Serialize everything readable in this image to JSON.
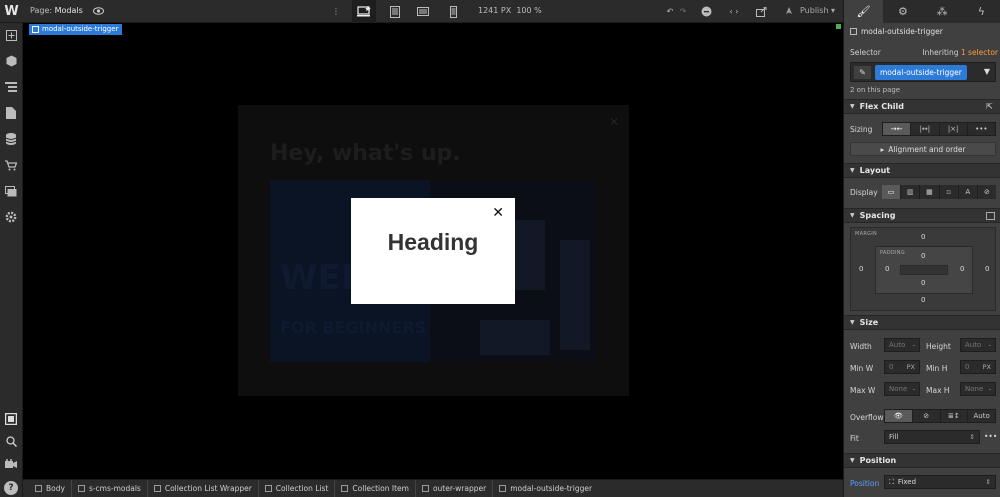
{
  "topbar": {
    "logo": "W",
    "page_prefix": "Page:",
    "page_name": "Modals",
    "canvas_width": "1241",
    "canvas_unit": "PX",
    "zoom": "100 %",
    "publish_label": "Publish"
  },
  "canvas": {
    "selected_tag": "modal-outside-trigger",
    "background_heading": "Hey, what's up.",
    "background_video_title": "WEB",
    "background_video_subtitle": "FOR BEGINNERS",
    "modal_heading": "Heading",
    "modal_close": "✕"
  },
  "breadcrumbs": [
    "Body",
    "s-cms-modals",
    "Collection List Wrapper",
    "Collection List",
    "Collection Item",
    "outer-wrapper",
    "modal-outside-trigger"
  ],
  "panel": {
    "element_name": "modal-outside-trigger",
    "selector_label": "Selector",
    "inheriting_label": "Inheriting",
    "inheriting_count": "1 selector",
    "selector_chip": "modal-outside-trigger",
    "on_page": "2 on this page",
    "flex_child": {
      "title": "Flex Child",
      "sizing_label": "Sizing",
      "alignment_button": "Alignment and order"
    },
    "layout": {
      "title": "Layout",
      "display_label": "Display"
    },
    "spacing": {
      "title": "Spacing",
      "margin_caption": "MARGIN",
      "padding_caption": "PADDING",
      "margin_top": "0",
      "margin_right": "0",
      "margin_bottom": "0",
      "margin_left": "0",
      "padding_top": "0",
      "padding_right": "0",
      "padding_bottom": "0",
      "padding_left": "0"
    },
    "size": {
      "title": "Size",
      "width_label": "Width",
      "width_value": "Auto",
      "height_label": "Height",
      "height_value": "Auto",
      "minw_label": "Min W",
      "minw_value": "0",
      "minw_unit": "PX",
      "minh_label": "Min H",
      "minh_value": "0",
      "minh_unit": "PX",
      "maxw_label": "Max W",
      "maxw_value": "None",
      "maxh_label": "Max H",
      "maxh_value": "None",
      "overflow_label": "Overflow",
      "overflow_auto": "Auto",
      "fit_label": "Fit",
      "fit_value": "Fill"
    },
    "position": {
      "title": "Position",
      "position_label": "Position",
      "position_value": "Fixed"
    }
  },
  "colors": {
    "accent_blue": "#2d7bd9",
    "inherit_orange": "#ff9b3b",
    "panel_bg": "#404040",
    "chrome_bg": "#2b2b2b"
  }
}
